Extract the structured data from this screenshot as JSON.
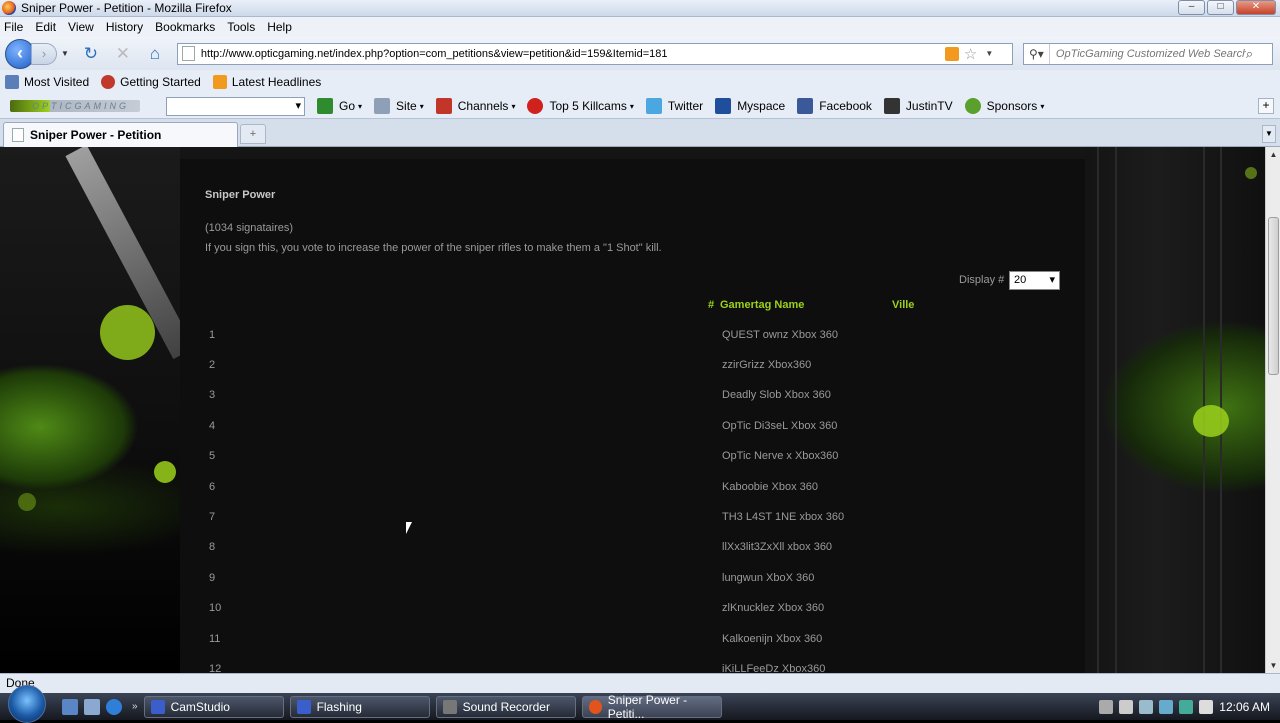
{
  "window": {
    "title": "Sniper Power - Petition - Mozilla Firefox"
  },
  "menu": [
    "File",
    "Edit",
    "View",
    "History",
    "Bookmarks",
    "Tools",
    "Help"
  ],
  "nav": {
    "url": "http://www.opticgaming.net/index.php?option=com_petitions&view=petition&id=159&Itemid=181",
    "search_placeholder": "OpTicGaming Customized Web Search"
  },
  "bookmarks": [
    "Most Visited",
    "Getting Started",
    "Latest Headlines"
  ],
  "toolbar2": {
    "logo": "OPTICGAMING",
    "items": [
      {
        "label": "Go",
        "color": "#2e8b2e"
      },
      {
        "label": "Site",
        "color": "#8ea0b8"
      },
      {
        "label": "Channels",
        "color": "#c2362a"
      },
      {
        "label": "Top 5 Killcams",
        "color": "#d0211c"
      },
      {
        "label": "Twitter",
        "color": "#4aa7e0"
      },
      {
        "label": "Myspace",
        "color": "#1f4f9c"
      },
      {
        "label": "Facebook",
        "color": "#3b5998"
      },
      {
        "label": "JustinTV",
        "color": "#333333"
      },
      {
        "label": "Sponsors",
        "color": "#5aa02c"
      }
    ]
  },
  "tab": {
    "label": "Sniper Power - Petition"
  },
  "page": {
    "title": "Sniper Power",
    "signatures": "(1034 signataires)",
    "description": "If you sign this, you vote to increase the power of the sniper rifles to make them a \"1 Shot\" kill.",
    "display_label": "Display #",
    "display_value": "20",
    "columns": {
      "hash": "#",
      "name": "Gamertag Name",
      "ville": "Ville"
    },
    "rows": [
      {
        "n": "1",
        "g": "QUEST ownz Xbox 360"
      },
      {
        "n": "2",
        "g": "zzirGrizz Xbox360"
      },
      {
        "n": "3",
        "g": "Deadly Slob Xbox 360"
      },
      {
        "n": "4",
        "g": "OpTic Di3seL Xbox 360"
      },
      {
        "n": "5",
        "g": "OpTic Nerve x Xbox360"
      },
      {
        "n": "6",
        "g": "Kaboobie Xbox 360"
      },
      {
        "n": "7",
        "g": "TH3 L4ST 1NE xbox 360"
      },
      {
        "n": "8",
        "g": "llXx3lit3ZxXll xbox 360"
      },
      {
        "n": "9",
        "g": "lungwun XboX 360"
      },
      {
        "n": "10",
        "g": "zlKnucklez Xbox 360"
      },
      {
        "n": "11",
        "g": "Kalkoenijn Xbox 360"
      },
      {
        "n": "12",
        "g": "iKiLLFeeDz Xbox360"
      }
    ]
  },
  "status": "Done",
  "taskbar": {
    "tasks": [
      {
        "label": "CamStudio",
        "color": "#3a5fcd"
      },
      {
        "label": "Flashing",
        "color": "#3a5fcd"
      },
      {
        "label": "Sound Recorder",
        "color": "#777777"
      },
      {
        "label": "Sniper Power - Petiti...",
        "color": "#e2541c"
      }
    ],
    "clock": "12:06 AM"
  },
  "colors": {
    "accent": "#9bd11b",
    "panel": "#0e0e0e"
  }
}
